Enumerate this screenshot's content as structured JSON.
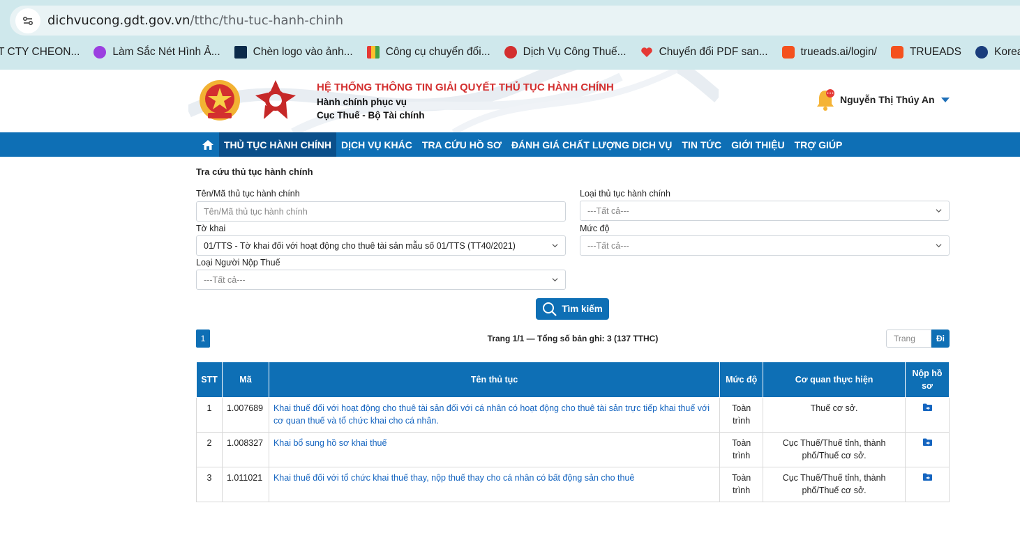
{
  "browser": {
    "url_domain": "dichvucong.gdt.gov.vn",
    "url_path": "/tthc/thu-tuc-hanh-chinh",
    "bookmarks": [
      {
        "label": "T CTY CHEON...",
        "icon": "folder-icon",
        "color": "#cfe8ec"
      },
      {
        "label": "Làm Sắc Nét Hình Ả...",
        "icon": "picsart-icon",
        "color": "#9b3fe0"
      },
      {
        "label": "Chèn logo vào ảnh...",
        "icon": "psd-icon",
        "color": "#0b2a4a"
      },
      {
        "label": "Công cụ chuyển đổi...",
        "icon": "grid-icon",
        "color": "#e8a23a"
      },
      {
        "label": "Dịch Vụ Công Thuế...",
        "icon": "emblem-icon",
        "color": "#d32f2f"
      },
      {
        "label": "Chuyển đổi PDF san...",
        "icon": "heart-icon",
        "color": "#e53935"
      },
      {
        "label": "trueads.ai/login/",
        "icon": "trueads-icon",
        "color": "#f4511e"
      },
      {
        "label": "TRUEADS",
        "icon": "trueads-icon",
        "color": "#f4511e"
      },
      {
        "label": "Korean Air",
        "icon": "koreanair-icon",
        "color": "#1a3d7c"
      }
    ]
  },
  "header": {
    "title": "HỆ THỐNG THÔNG TIN GIẢI QUYẾT THỦ TỤC HÀNH CHÍNH",
    "subtitle1": "Hành chính phục vụ",
    "subtitle2": "Cục Thuế - Bộ Tài chính",
    "user_name": "Nguyễn Thị Thúy An"
  },
  "nav": {
    "items": [
      {
        "label": "THỦ TỤC HÀNH CHÍNH",
        "active": true
      },
      {
        "label": "DỊCH VỤ KHÁC"
      },
      {
        "label": "TRA CỨU HỒ SƠ"
      },
      {
        "label": "ĐÁNH GIÁ CHẤT LƯỢNG DỊCH VỤ"
      },
      {
        "label": "TIN TỨC"
      },
      {
        "label": "GIỚI THIỆU"
      },
      {
        "label": "TRỢ GIÚP"
      }
    ]
  },
  "search": {
    "section_title": "Tra cứu thủ tục hành chính",
    "name_label": "Tên/Mã thủ tục hành chính",
    "name_placeholder": "Tên/Mã thủ tục hành chính",
    "type_label": "Loại thủ tục hành chính",
    "type_value": "---Tất cả---",
    "form_label": "Tờ khai",
    "form_value": "01/TTS - Tờ khai đối với hoạt động cho thuê tài sản mẫu số 01/TTS (TT40/2021)",
    "level_label": "Mức độ",
    "level_value": "---Tất cả---",
    "payer_label": "Loại Người Nộp Thuế",
    "payer_value": "---Tất cả---",
    "button_label": "Tìm kiếm"
  },
  "pagination": {
    "current_page": "1",
    "info": "Trang 1/1 — Tổng số bản ghi: 3 (137 TTHC)",
    "goto_placeholder": "Trang",
    "goto_button": "Đi"
  },
  "table": {
    "headers": {
      "stt": "STT",
      "ma": "Mã",
      "ten": "Tên thủ tục",
      "muc_do": "Mức độ",
      "co_quan": "Cơ quan thực hiện",
      "nop_ho_so": "Nộp hồ sơ"
    },
    "rows": [
      {
        "stt": "1",
        "ma": "1.007689",
        "ten": "Khai thuế đối với hoạt động cho thuê tài sản đối với cá nhân có hoạt động cho thuê tài sản trực tiếp khai thuế với cơ quan thuế và tổ chức khai cho cá nhân.",
        "muc_do": "Toàn trình",
        "co_quan": "Thuế cơ sở."
      },
      {
        "stt": "2",
        "ma": "1.008327",
        "ten": "Khai bổ sung hồ sơ khai thuế",
        "muc_do": "Toàn trình",
        "co_quan": "Cục Thuế/Thuế tỉnh, thành phố/Thuế cơ sở."
      },
      {
        "stt": "3",
        "ma": "1.011021",
        "ten": "Khai thuế đối với tổ chức khai thuế thay, nộp thuế thay cho cá nhân có bất động sản cho thuê",
        "muc_do": "Toàn trình",
        "co_quan": "Cục Thuế/Thuế tỉnh, thành phố/Thuế cơ sở."
      }
    ]
  },
  "colors": {
    "primary": "#0e6fb5",
    "nav_active": "#0a4f8a",
    "title_red": "#d32f2f",
    "link": "#1565c0"
  }
}
